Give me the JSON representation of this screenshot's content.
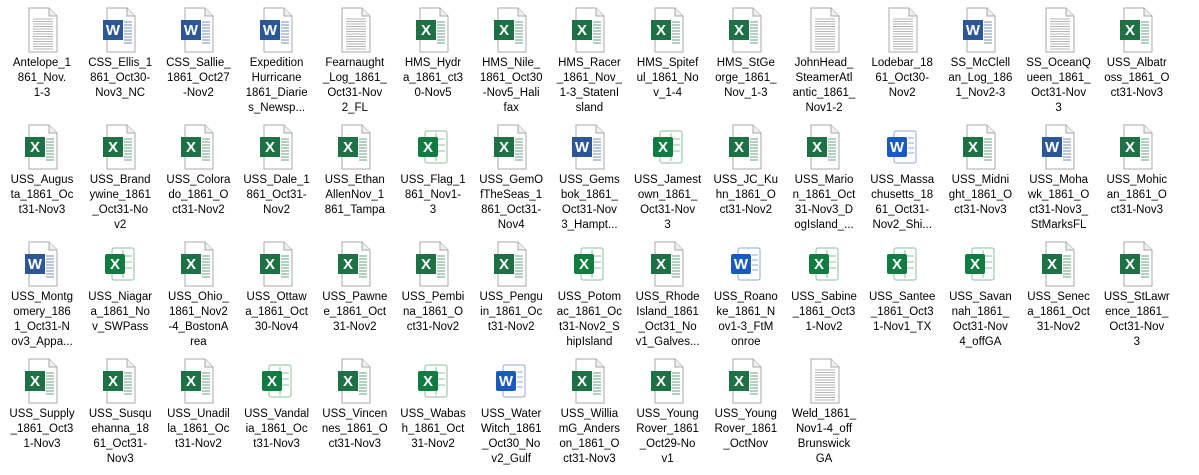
{
  "files": [
    {
      "name": "Antelope_1861_Nov1-3",
      "label_lines": [
        "Antelope_1",
        "861_Nov.",
        "1-3"
      ],
      "type": "txt"
    },
    {
      "name": "CSS_Ellis_1861_Oct30-Nov3_NC",
      "label_lines": [
        "CSS_Ellis_1",
        "861_Oct30-",
        "Nov3_NC"
      ],
      "type": "word"
    },
    {
      "name": "CSS_Sallie_1861_Oct27-Nov2",
      "label_lines": [
        "CSS_Sallie_",
        "1861_Oct27",
        "-Nov2"
      ],
      "type": "word"
    },
    {
      "name": "Expedition Hurricane 1861_Diaries_Newsp",
      "label_lines": [
        "Expedition",
        "Hurricane",
        "1861_Diarie",
        "s_Newsp..."
      ],
      "type": "word"
    },
    {
      "name": "Fearnaught_Log_1861_Oct31-Nov2_FL",
      "label_lines": [
        "Fearnaught",
        "_Log_1861_",
        "Oct31-Nov",
        "2_FL"
      ],
      "type": "txt"
    },
    {
      "name": "HMS_Hydra_1861_Oct30-Nov5",
      "label_lines": [
        "HMS_Hydr",
        "a_1861_ct3",
        "0-Nov5"
      ],
      "type": "excel"
    },
    {
      "name": "HMS_Nile_1861_Oct30-Nov5_Halifax",
      "label_lines": [
        "HMS_Nile_",
        "1861_Oct30",
        "-Nov5_Hali",
        "fax"
      ],
      "type": "excel"
    },
    {
      "name": "HMS_Racer_1861_Nov_1-3_StatenIsland",
      "label_lines": [
        "HMS_Racer",
        "_1861_Nov_",
        "1-3_StatenI",
        "sland"
      ],
      "type": "excel"
    },
    {
      "name": "HMS_Spiteful_1861_Nov_1-4",
      "label_lines": [
        "HMS_Spitef",
        "ul_1861_No",
        "v_1-4"
      ],
      "type": "excel"
    },
    {
      "name": "HMS_StGeorge_1861_Nov_1-3",
      "label_lines": [
        "HMS_StGe",
        "orge_1861_",
        "Nov_1-3"
      ],
      "type": "excel"
    },
    {
      "name": "JohnHead_SteamerAtlantic_1861_Nov1-2",
      "label_lines": [
        "JohnHead_",
        "SteamerAtl",
        "antic_1861_",
        "Nov1-2"
      ],
      "type": "txt"
    },
    {
      "name": "Lodebar_1861_Oct30-Nov2",
      "label_lines": [
        "Lodebar_18",
        "61_Oct30-",
        "Nov2"
      ],
      "type": "txt"
    },
    {
      "name": "SS_McClellan_Log_1861_Nov2-3",
      "label_lines": [
        "SS_McClell",
        "an_Log_186",
        "1_Nov2-3"
      ],
      "type": "word"
    },
    {
      "name": "SS_OceanQueen_1861_Oct31-Nov3",
      "label_lines": [
        "SS_OceanQ",
        "ueen_1861_",
        "Oct31-Nov",
        "3"
      ],
      "type": "txt"
    },
    {
      "name": "USS_Albatross_1861_Oct31-Nov3",
      "label_lines": [
        "USS_Albatr",
        "oss_1861_O",
        "ct31-Nov3"
      ],
      "type": "excel"
    },
    {
      "name": "USS_Augusta_1861_Oct31-Nov3",
      "label_lines": [
        "USS_Augus",
        "ta_1861_Oc",
        "t31-Nov3"
      ],
      "type": "excel"
    },
    {
      "name": "USS_Brandywine_1861_Oct31-Nov2",
      "label_lines": [
        "USS_Brand",
        "ywine_1861",
        "_Oct31-No",
        "v2"
      ],
      "type": "excel"
    },
    {
      "name": "USS_Colorado_1861_Oct31-Nov2",
      "label_lines": [
        "USS_Colora",
        "do_1861_O",
        "ct31-Nov2"
      ],
      "type": "excel"
    },
    {
      "name": "USS_Dale_1861_Oct31-Nov2",
      "label_lines": [
        "USS_Dale_1",
        "861_Oct31-",
        "Nov2"
      ],
      "type": "excel"
    },
    {
      "name": "USS_EthanAllenNov_1861_Tampa",
      "label_lines": [
        "USS_Ethan",
        "AllenNov_1",
        "861_Tampa"
      ],
      "type": "excel"
    },
    {
      "name": "USS_Flag_1861_Nov1-3",
      "label_lines": [
        "USS_Flag_1",
        "861_Nov1-",
        "3"
      ],
      "type": "excel-new"
    },
    {
      "name": "USS_GemOfTheSeas_1861_Oct31-Nov4",
      "label_lines": [
        "USS_GemO",
        "fTheSeas_1",
        "861_Oct31-",
        "Nov4"
      ],
      "type": "excel"
    },
    {
      "name": "USS_Gemsbok_1861_Oct31-Nov3_Hampt",
      "label_lines": [
        "USS_Gems",
        "bok_1861_",
        "Oct31-Nov",
        "3_Hampt..."
      ],
      "type": "word"
    },
    {
      "name": "USS_Jamestown_1861_Oct31-Nov3",
      "label_lines": [
        "USS_Jamest",
        "own_1861_",
        "Oct31-Nov",
        "3"
      ],
      "type": "excel-new"
    },
    {
      "name": "USS_JC_Kuhn_1861_Oct31-Nov2",
      "label_lines": [
        "USS_JC_Ku",
        "hn_1861_O",
        "ct31-Nov2"
      ],
      "type": "excel"
    },
    {
      "name": "USS_Marion_1861_Oct31-Nov3_DogIsland",
      "label_lines": [
        "USS_Mario",
        "n_1861_Oct",
        "31-Nov3_D",
        "ogIsland_..."
      ],
      "type": "excel"
    },
    {
      "name": "USS_Massachusetts_1861_Oct31-Nov2_Shi",
      "label_lines": [
        "USS_Massa",
        "chusetts_18",
        "61_Oct31-",
        "Nov2_Shi..."
      ],
      "type": "word-new"
    },
    {
      "name": "USS_Midnight_1861_Oct31-Nov3",
      "label_lines": [
        "USS_Midni",
        "ght_1861_O",
        "ct31-Nov3"
      ],
      "type": "excel"
    },
    {
      "name": "USS_Mohawk_1861_Oct31-Nov3_StMarksFL",
      "label_lines": [
        "USS_Moha",
        "wk_1861_O",
        "ct31-Nov3_",
        "StMarksFL"
      ],
      "type": "word"
    },
    {
      "name": "USS_Mohican_1861_Oct31-Nov3",
      "label_lines": [
        "USS_Mohic",
        "an_1861_O",
        "ct31-Nov3"
      ],
      "type": "excel"
    },
    {
      "name": "USS_Montgomery_1861_Oct31-Nov3_Appa",
      "label_lines": [
        "USS_Montg",
        "omery_186",
        "1_Oct31-N",
        "ov3_Appa..."
      ],
      "type": "word"
    },
    {
      "name": "USS_Niagara_1861_Nov_SWPass",
      "label_lines": [
        "USS_Niagar",
        "a_1861_No",
        "v_SWPass"
      ],
      "type": "excel-new"
    },
    {
      "name": "USS_Ohio_1861_Nov2-4_BostonArea",
      "label_lines": [
        "USS_Ohio_",
        "1861_Nov2",
        "-4_BostonA",
        "rea"
      ],
      "type": "excel"
    },
    {
      "name": "USS_Ottawa_1861_Oct30-Nov4",
      "label_lines": [
        "USS_Ottaw",
        "a_1861_Oct",
        "30-Nov4"
      ],
      "type": "excel"
    },
    {
      "name": "USS_Pawnee_1861_Oct31-Nov2",
      "label_lines": [
        "USS_Pawne",
        "e_1861_Oct",
        "31-Nov2"
      ],
      "type": "excel"
    },
    {
      "name": "USS_Pembina_1861_Oct31-Nov2",
      "label_lines": [
        "USS_Pembi",
        "na_1861_O",
        "ct31-Nov2"
      ],
      "type": "excel"
    },
    {
      "name": "USS_Penguin_1861_Oct31-Nov2",
      "label_lines": [
        "USS_Pengu",
        "in_1861_Oc",
        "t31-Nov2"
      ],
      "type": "excel"
    },
    {
      "name": "USS_Potomac_1861_Oct31-Nov2_ShipIsland",
      "label_lines": [
        "USS_Potom",
        "ac_1861_Oc",
        "t31-Nov2_S",
        "hipIsland"
      ],
      "type": "excel-new"
    },
    {
      "name": "USS_RhodeIsland_1861_Oct31_Nov1_Galves",
      "label_lines": [
        "USS_Rhode",
        "Island_1861",
        "_Oct31_No",
        "v1_Galves..."
      ],
      "type": "excel"
    },
    {
      "name": "USS_Roanoke_1861_Nov1-3_FtMonroe",
      "label_lines": [
        "USS_Roano",
        "ke_1861_N",
        "ov1-3_FtM",
        "onroe"
      ],
      "type": "word-new"
    },
    {
      "name": "USS_Sabine_1861_Oct31-Nov2",
      "label_lines": [
        "USS_Sabine",
        "_1861_Oct3",
        "1-Nov2"
      ],
      "type": "excel-new"
    },
    {
      "name": "USS_Santee_1861_Oct31-Nov1_TX",
      "label_lines": [
        "USS_Santee",
        "_1861_Oct3",
        "1-Nov1_TX"
      ],
      "type": "excel-new"
    },
    {
      "name": "USS_Savannah_1861_Oct31-Nov4_offGA",
      "label_lines": [
        "USS_Savan",
        "nah_1861_",
        "Oct31-Nov",
        "4_offGA"
      ],
      "type": "excel-new"
    },
    {
      "name": "USS_Seneca_1861_Oct31-Nov2",
      "label_lines": [
        "USS_Senec",
        "a_1861_Oct",
        "31-Nov2"
      ],
      "type": "excel"
    },
    {
      "name": "USS_StLawrence_1861_Oct31-Nov3",
      "label_lines": [
        "USS_StLawr",
        "ence_1861_",
        "Oct31-Nov",
        "3"
      ],
      "type": "excel"
    },
    {
      "name": "USS_Supply_1861_Oct31-Nov3",
      "label_lines": [
        "USS_Supply",
        "_1861_Oct3",
        "1-Nov3"
      ],
      "type": "excel"
    },
    {
      "name": "USS_Susquehanna_1861_Oct31-Nov3",
      "label_lines": [
        "USS_Susqu",
        "ehanna_18",
        "61_Oct31-",
        "Nov3"
      ],
      "type": "excel"
    },
    {
      "name": "USS_Unadilla_1861_Oct31-Nov2",
      "label_lines": [
        "USS_Unadil",
        "la_1861_Oc",
        "t31-Nov2"
      ],
      "type": "excel"
    },
    {
      "name": "USS_Vandalia_1861_Oct31-Nov3",
      "label_lines": [
        "USS_Vandal",
        "ia_1861_Oc",
        "t31-Nov3"
      ],
      "type": "excel-new"
    },
    {
      "name": "USS_Vincennes_1861_Oct31-Nov3",
      "label_lines": [
        "USS_Vincen",
        "nes_1861_O",
        "ct31-Nov3"
      ],
      "type": "excel"
    },
    {
      "name": "USS_Wabash_1861_Oct31-Nov2",
      "label_lines": [
        "USS_Wabas",
        "h_1861_Oct",
        "31-Nov2"
      ],
      "type": "excel-new"
    },
    {
      "name": "USS_WaterWitch_1861_Oct30_Nov2_Gulf",
      "label_lines": [
        "USS_Water",
        "Witch_1861",
        "_Oct30_No",
        "v2_Gulf"
      ],
      "type": "word-new"
    },
    {
      "name": "USS_WilliamG_Anderson_1861_Oct31-Nov3",
      "label_lines": [
        "USS_Willia",
        "mG_Anders",
        "on_1861_O",
        "ct31-Nov3"
      ],
      "type": "excel"
    },
    {
      "name": "USS_YoungRover_1861_Oct29-Nov1",
      "label_lines": [
        "USS_Young",
        "Rover_1861",
        "_Oct29-No",
        "v1"
      ],
      "type": "excel"
    },
    {
      "name": "USS_YoungRover_1861_OctNov",
      "label_lines": [
        "USS_Young",
        "Rover_1861",
        "_OctNov"
      ],
      "type": "excel"
    },
    {
      "name": "Weld_1861_Nov1-4_off Brunswick GA",
      "label_lines": [
        "Weld_1861_",
        "Nov1-4_off",
        "Brunswick",
        "GA"
      ],
      "type": "txt"
    }
  ],
  "icons": {
    "word": "word-document-icon",
    "word-new": "word-document-icon",
    "excel": "excel-spreadsheet-icon",
    "excel-new": "excel-spreadsheet-icon",
    "txt": "text-document-icon"
  },
  "colors": {
    "word_blue": "#2b5797",
    "word_new_blue": "#185abd",
    "excel_green": "#1e7145",
    "excel_new_green": "#107c41",
    "page_border": "#a8a8a8",
    "page_fill": "#ffffff",
    "text_line": "#9e9e9e"
  }
}
